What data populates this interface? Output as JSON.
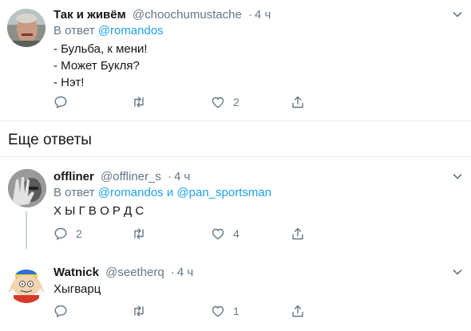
{
  "tweets": [
    {
      "name": "Так и живём",
      "handle": "@choochumustache",
      "time": "4 ч",
      "reply_prefix": "В ответ",
      "reply_mentions": [
        "@romandos"
      ],
      "text": "- Бульба, к мени!\n- Может Букля?\n- Нэт!",
      "reply_count": "",
      "retweet_count": "",
      "like_count": "2"
    },
    {
      "name": "offliner",
      "handle": "@offliner_s",
      "time": "4 ч",
      "reply_prefix": "В ответ",
      "reply_mentions": [
        "@romandos",
        "@pan_sportsman"
      ],
      "reply_joiner": "и",
      "text": "Х Ы Г В О Р Д С",
      "reply_count": "2",
      "retweet_count": "",
      "like_count": "4"
    },
    {
      "name": "Watnick",
      "handle": "@seetherq",
      "time": "4 ч",
      "text": "Хыгварц",
      "reply_count": "",
      "retweet_count": "",
      "like_count": "1"
    }
  ],
  "section": {
    "more_replies": "Еще ответы"
  },
  "colors": {
    "accent": "#1da1f2",
    "muted": "#657786",
    "divider": "#e6ecf0"
  }
}
